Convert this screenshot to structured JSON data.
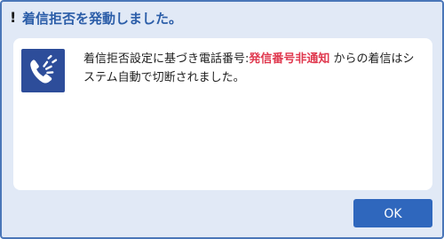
{
  "dialog": {
    "title_icon": "!",
    "title": "着信拒否を発動しました。",
    "icon_name": "phone-ringing-icon",
    "message": {
      "part1": "着信拒否設定に基づき電話番号:",
      "highlight": "発信番号非通知",
      "part2": " からの着信はシステム自動で切断されました。"
    },
    "ok_label": "OK"
  },
  "colors": {
    "title_text": "#2b5da8",
    "dialog_background": "#e1e9f6",
    "dialog_border": "#4a76b8",
    "icon_background": "#2d4d9a",
    "highlight_text": "#e0394f",
    "ok_button": "#2f67bd"
  }
}
